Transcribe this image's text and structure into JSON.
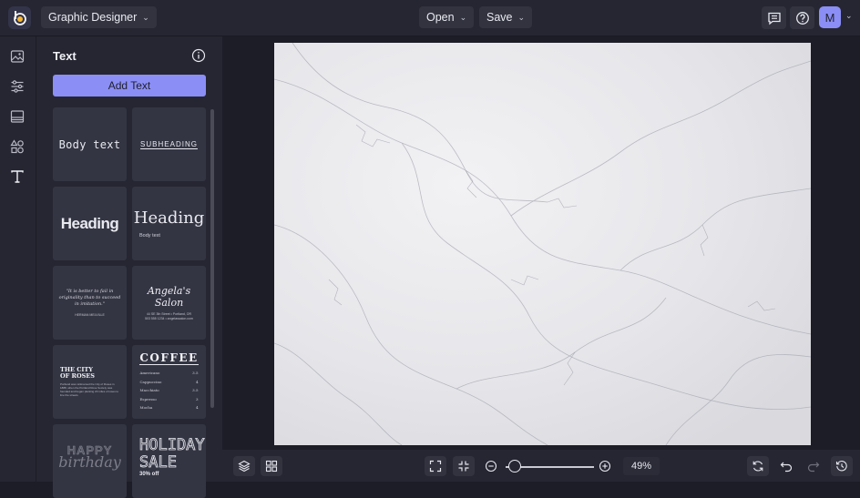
{
  "header": {
    "app_menu_label": "Graphic Designer",
    "open_label": "Open",
    "save_label": "Save",
    "avatar_initial": "M"
  },
  "rail": {
    "items": [
      "photos-icon",
      "adjustments-icon",
      "layout-icon",
      "graphics-icon",
      "text-icon"
    ],
    "active": "text-icon"
  },
  "panel": {
    "title": "Text",
    "add_button": "Add Text",
    "tiles": {
      "body_text": "Body text",
      "subheading": "SUBHEADING",
      "heading_bold": "Heading",
      "heading_serif": "Heading",
      "heading_serif_body": "Body text",
      "quote": "\"It is better to fail in originality than to succeed in imitation.\"",
      "quote_author": "HERMAN MELVILLE",
      "salon_title": "Angela's Salon",
      "salon_line1": "44 SE 3th Street • Portland, OR",
      "salon_line2": "503 555 1234 • angelassalon.com",
      "city_title_1": "THE CITY",
      "city_title_2": "OF ROSES",
      "city_paragraph": "Portland was nicknamed the City of Roses in 1888, when the Portland Rose Society was founded and began planting 20 miles of roses to line the streets.",
      "coffee_title": "COFFEE",
      "coffee_menu": [
        {
          "item": "Americano",
          "price": "3.5"
        },
        {
          "item": "Cappuccino",
          "price": "4"
        },
        {
          "item": "Macchiato",
          "price": "3.5"
        },
        {
          "item": "Espresso",
          "price": "3"
        },
        {
          "item": "Mocha",
          "price": "4"
        }
      ],
      "happy": "HAPPY",
      "birthday": "birthday",
      "holiday_1": "HOLIDAY",
      "holiday_2": "SALE",
      "holiday_offer": "30% off"
    }
  },
  "canvas": {
    "background": "white marble texture",
    "color": "#e9e9ec"
  },
  "bottom_bar": {
    "zoom_value": "49%",
    "zoom_level": 0.49
  },
  "colors": {
    "accent": "#8b8ef5",
    "panel_bg": "#252631",
    "app_bg": "#1c1d27"
  }
}
